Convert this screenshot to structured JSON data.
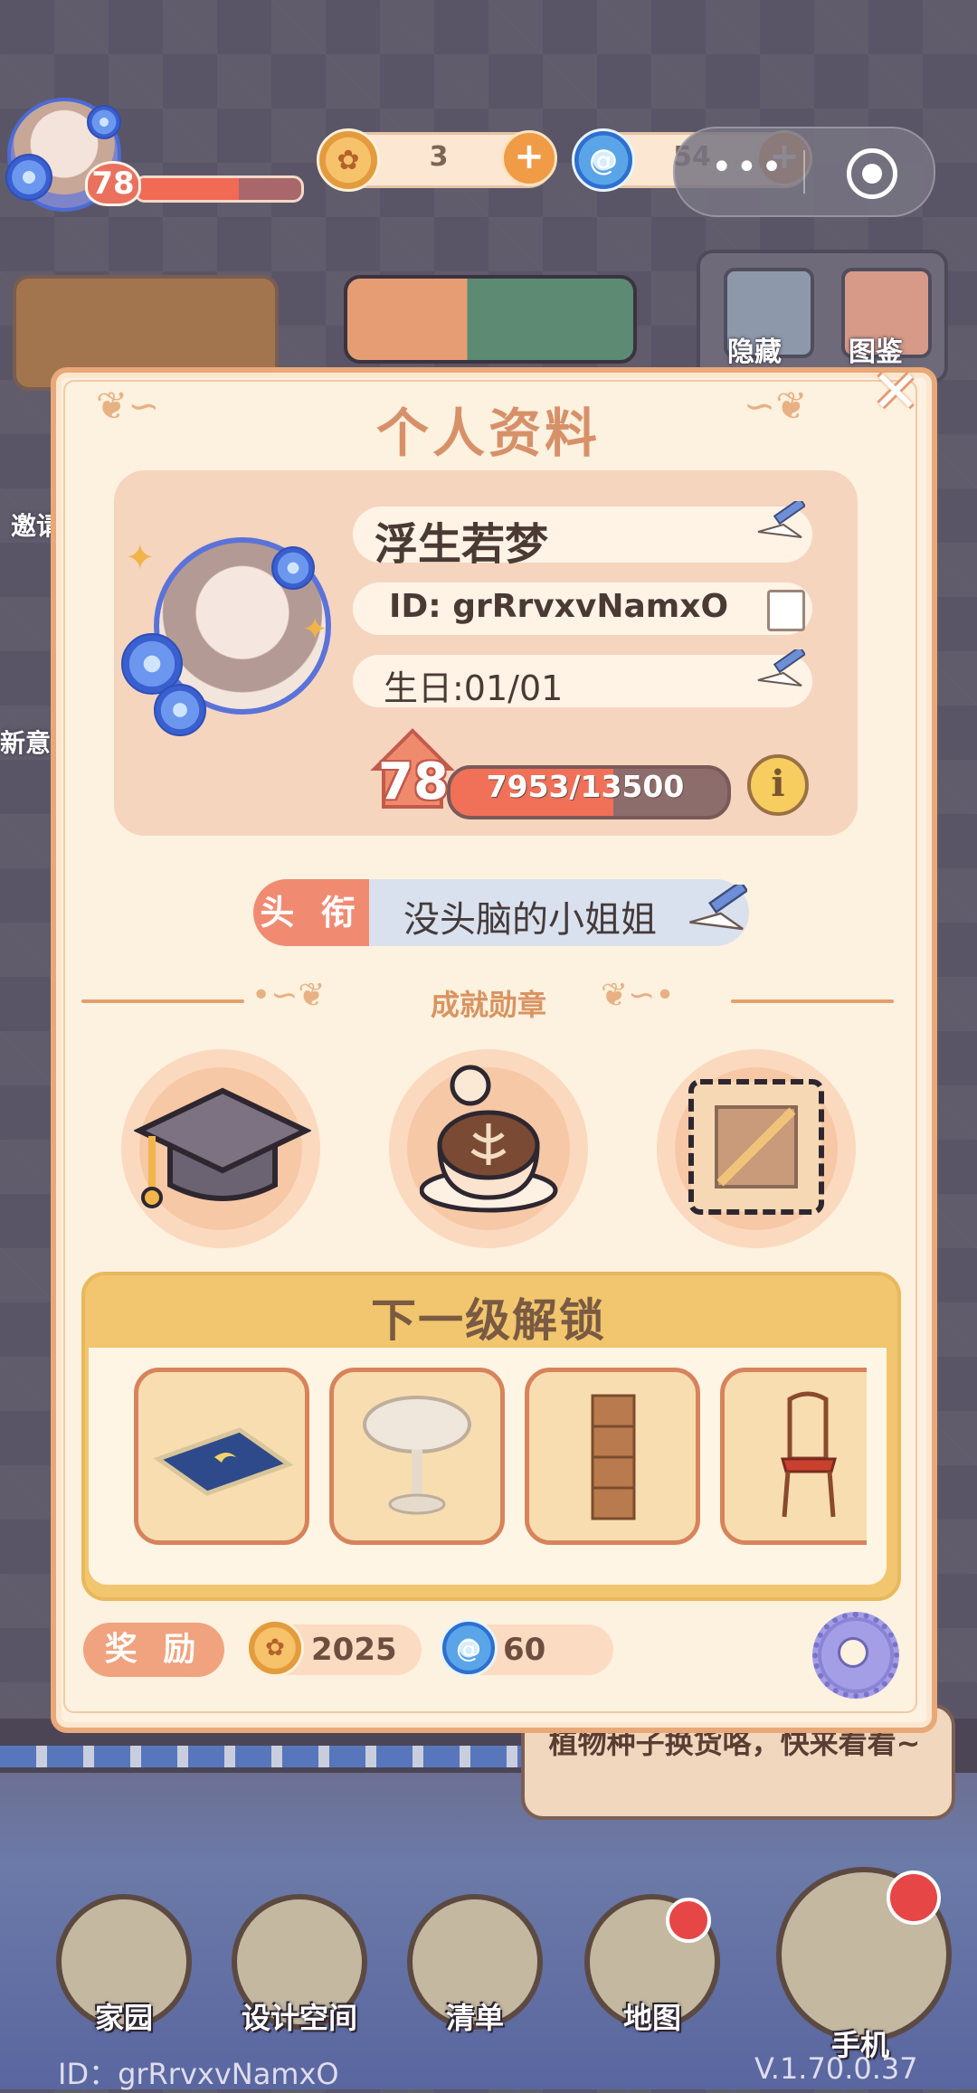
{
  "hud": {
    "level": "78",
    "coins": "3",
    "gems": "54",
    "capsule_dots": "•••"
  },
  "side_menu": {
    "hide_label": "隐藏",
    "collection_label": "图鉴",
    "invite_label": "邀请",
    "new_label": "新意"
  },
  "modal": {
    "title": "个人资料",
    "close_glyph": "✕",
    "nickname": "浮生若梦",
    "user_id": "ID: grRrvxvNamxO",
    "birthday": "生日:01/01",
    "level": "78",
    "xp_text": "7953/13500",
    "xp_progress": 0.589,
    "info_glyph": "i",
    "title_label": "头 衔",
    "title_value": "没头脑的小姐姐",
    "achievements_label": "成就勋章",
    "medals": [
      "graduation-cap-icon",
      "latte-cup-icon",
      "stamp-icon"
    ],
    "unlock_title": "下一级解锁",
    "unlock_items": [
      "rug-icon",
      "round-table-icon",
      "bookshelf-icon",
      "chair-icon"
    ],
    "reward_label": "奖 励",
    "reward_coins": "2025",
    "reward_gems": "60"
  },
  "scene": {
    "speech_bubble": "植物种子换货咯，快来看看~"
  },
  "nav": {
    "home": "家园",
    "design": "设计空间",
    "list": "清单",
    "map": "地图",
    "phone": "手机"
  },
  "footer": {
    "user_id": "ID：grRrvxvNamxO",
    "version": "V.1.70.0.37"
  },
  "colors": {
    "accent": "#e9a878",
    "title": "#d7916a",
    "xp_fill": "#f07058",
    "gold": "#f2c66e"
  }
}
